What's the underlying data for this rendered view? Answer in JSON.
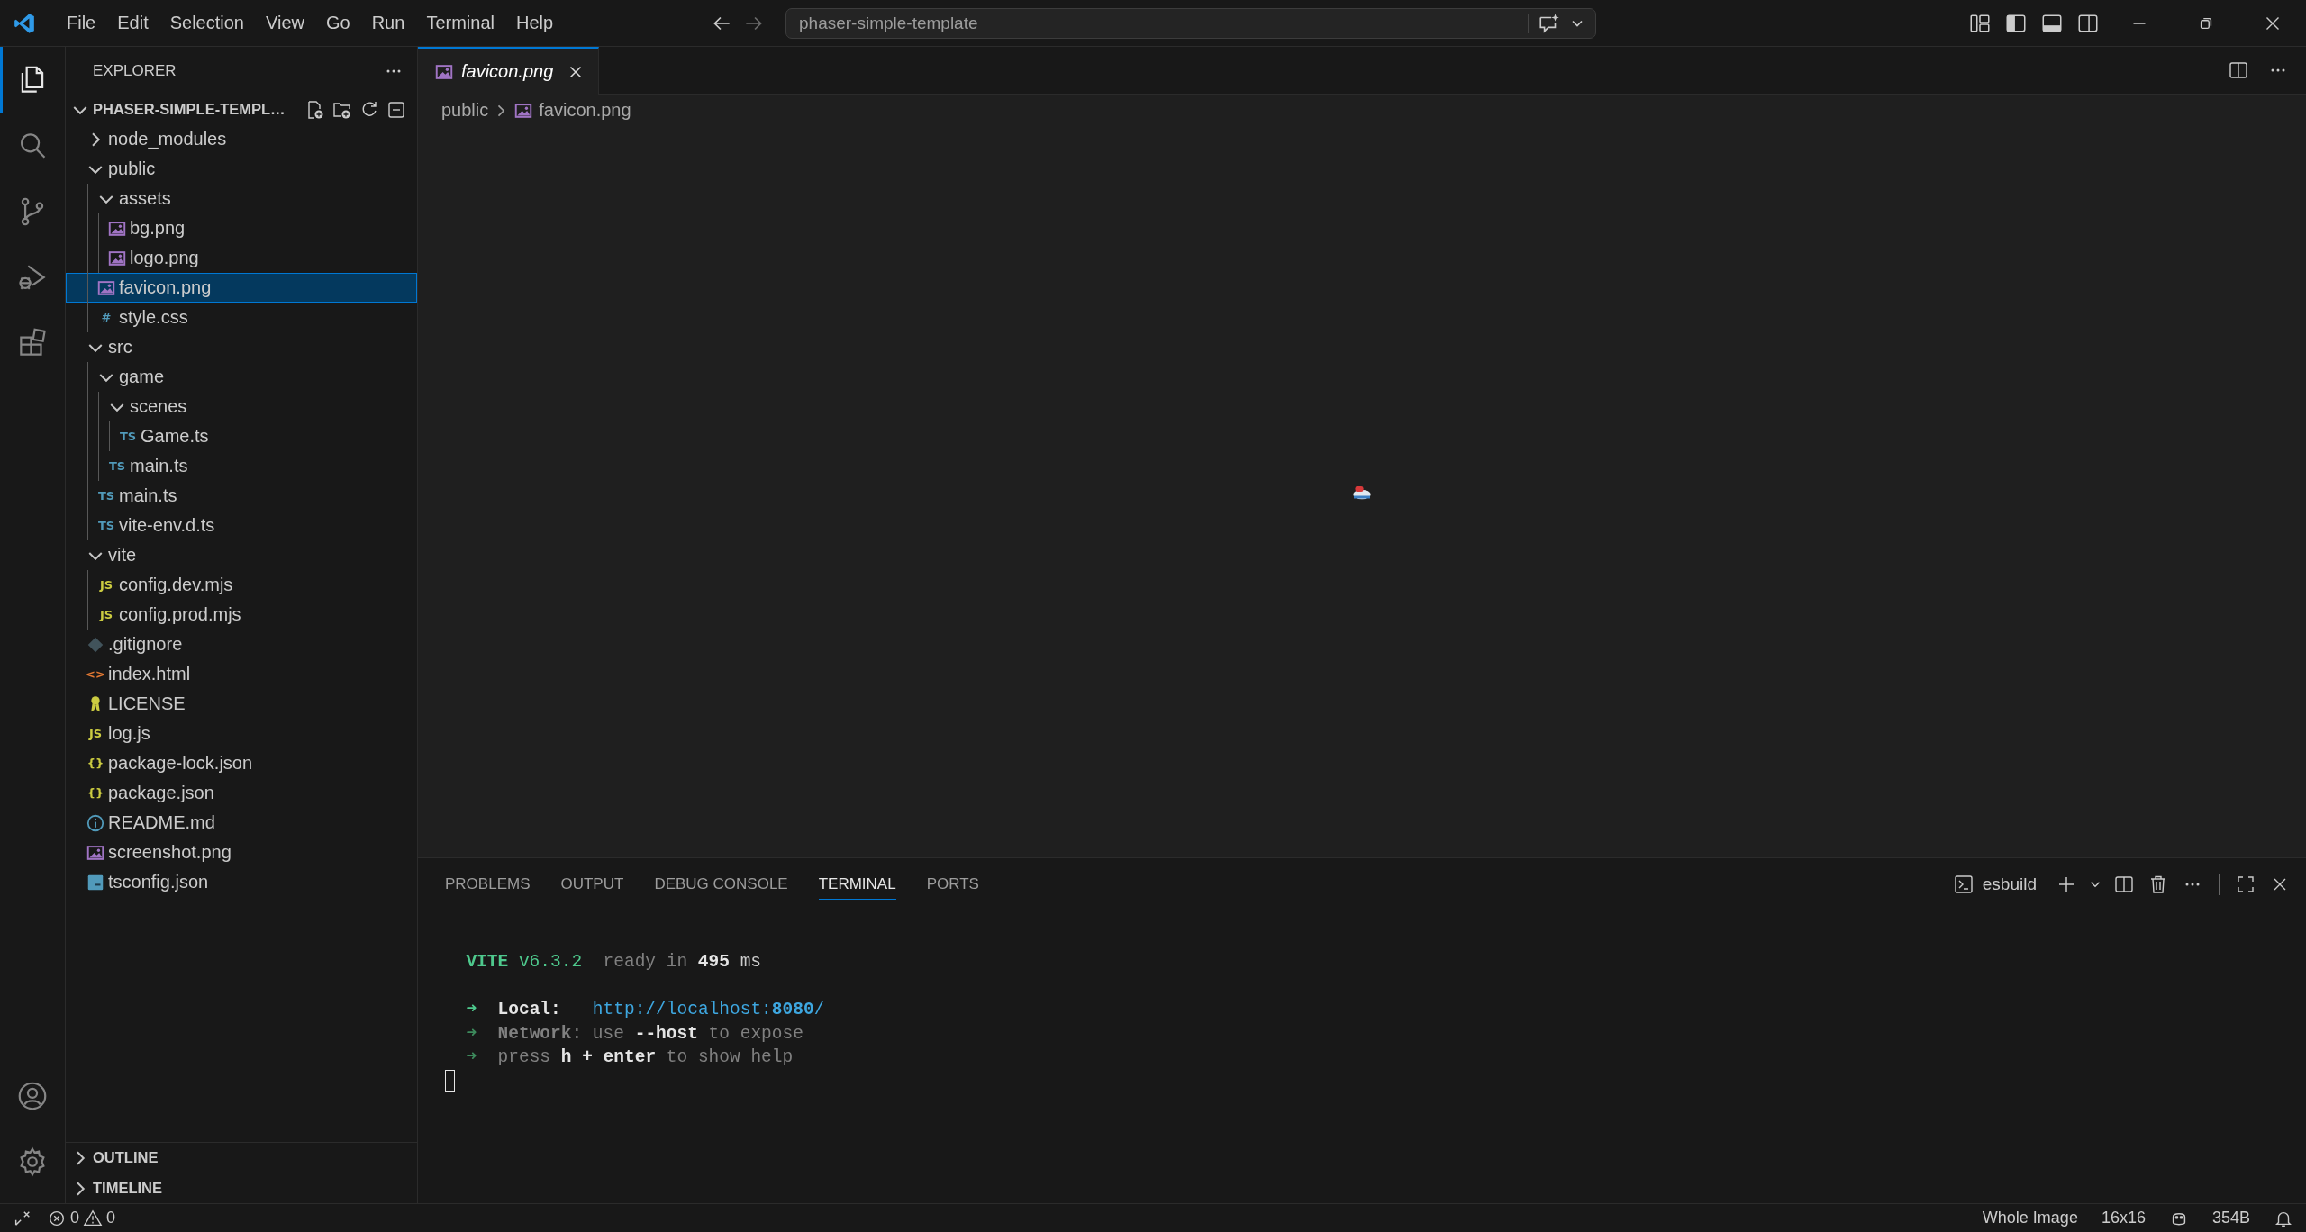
{
  "title_bar": {
    "menu": [
      "File",
      "Edit",
      "Selection",
      "View",
      "Go",
      "Run",
      "Terminal",
      "Help"
    ],
    "command_center": {
      "label": "phaser-simple-template"
    }
  },
  "activity_bar": {
    "items": [
      {
        "kind": "explorer",
        "selected": true
      },
      {
        "kind": "search",
        "selected": false
      },
      {
        "kind": "source-control",
        "selected": false
      },
      {
        "kind": "run-debug",
        "selected": false
      },
      {
        "kind": "extensions",
        "selected": false
      }
    ],
    "bottom": [
      {
        "kind": "account"
      },
      {
        "kind": "settings"
      }
    ]
  },
  "sidebar": {
    "title": "EXPLORER",
    "root": {
      "label": "PHASER-SIMPLE-TEMPL…",
      "expanded": true
    },
    "tree": [
      {
        "label": "node_modules",
        "kind": "folder",
        "expanded": false,
        "selected": false
      },
      {
        "label": "public",
        "kind": "folder",
        "expanded": true,
        "selected": false,
        "children": [
          {
            "label": "assets",
            "kind": "folder",
            "expanded": true,
            "selected": false,
            "children": [
              {
                "label": "bg.png",
                "kind": "image",
                "selected": false
              },
              {
                "label": "logo.png",
                "kind": "image",
                "selected": false
              }
            ]
          },
          {
            "label": "favicon.png",
            "kind": "image",
            "selected": true
          },
          {
            "label": "style.css",
            "kind": "glyph",
            "glyph": "#",
            "selected": false
          }
        ]
      },
      {
        "label": "src",
        "kind": "folder",
        "expanded": true,
        "selected": false,
        "children": [
          {
            "label": "game",
            "kind": "folder",
            "expanded": true,
            "selected": false,
            "children": [
              {
                "label": "scenes",
                "kind": "folder",
                "expanded": true,
                "selected": false,
                "children": [
                  {
                    "label": "Game.ts",
                    "kind": "glyph",
                    "glyph": "TS",
                    "selected": false
                  }
                ]
              },
              {
                "label": "main.ts",
                "kind": "glyph",
                "glyph": "TS",
                "selected": false
              }
            ]
          },
          {
            "label": "main.ts",
            "kind": "glyph",
            "glyph": "TS",
            "selected": false
          },
          {
            "label": "vite-env.d.ts",
            "kind": "glyph",
            "glyph": "TS",
            "selected": false
          }
        ]
      },
      {
        "label": "vite",
        "kind": "folder",
        "expanded": true,
        "selected": false,
        "children": [
          {
            "label": "config.dev.mjs",
            "kind": "glyph",
            "glyph": "JS",
            "selected": false
          },
          {
            "label": "config.prod.mjs",
            "kind": "glyph",
            "glyph": "JS",
            "selected": false
          }
        ]
      },
      {
        "label": ".gitignore",
        "kind": "git",
        "selected": false
      },
      {
        "label": "index.html",
        "kind": "glyph",
        "glyph": "<>",
        "selected": false
      },
      {
        "label": "LICENSE",
        "kind": "license",
        "selected": false
      },
      {
        "label": "log.js",
        "kind": "glyph",
        "glyph": "JS",
        "selected": false
      },
      {
        "label": "package-lock.json",
        "kind": "glyph",
        "glyph": "{}",
        "selected": false
      },
      {
        "label": "package.json",
        "kind": "glyph",
        "glyph": "{}",
        "selected": false
      },
      {
        "label": "README.md",
        "kind": "info",
        "selected": false
      },
      {
        "label": "screenshot.png",
        "kind": "image",
        "selected": false
      },
      {
        "label": "tsconfig.json",
        "kind": "tsconfig",
        "selected": false
      }
    ],
    "sections": [
      {
        "label": "OUTLINE",
        "expanded": false
      },
      {
        "label": "TIMELINE",
        "expanded": false
      }
    ]
  },
  "editor": {
    "tabs": [
      {
        "label": "favicon.png",
        "kind": "image",
        "selected": true,
        "preview": true
      }
    ],
    "breadcrumb": [
      {
        "label": "public",
        "kind": "folder"
      },
      {
        "label": "favicon.png",
        "kind": "image"
      }
    ]
  },
  "panel": {
    "tabs": [
      {
        "label": "PROBLEMS",
        "selected": false
      },
      {
        "label": "OUTPUT",
        "selected": false
      },
      {
        "label": "DEBUG CONSOLE",
        "selected": false
      },
      {
        "label": "TERMINAL",
        "selected": true
      },
      {
        "label": "PORTS",
        "selected": false
      }
    ],
    "terminal": {
      "name": "esbuild",
      "lines": [
        {
          "kind": "header",
          "segments": [
            {
              "text": "VITE",
              "kind": "accent-strong"
            },
            {
              "text": " v6.3.2",
              "kind": "accent"
            },
            {
              "text": "  ready in ",
              "kind": "muted"
            },
            {
              "text": "495",
              "kind": "strong"
            },
            {
              "text": " ms",
              "kind": "plain"
            }
          ]
        },
        {
          "kind": "entry",
          "segments": [
            {
              "text": "➜",
              "kind": "accent-strong"
            },
            {
              "text": "  Local:",
              "kind": "strong"
            },
            {
              "text": "   http://localhost:",
              "kind": "link"
            },
            {
              "text": "8080",
              "kind": "link-strong"
            },
            {
              "text": "/",
              "kind": "link"
            }
          ]
        },
        {
          "kind": "entry",
          "segments": [
            {
              "text": "➜",
              "kind": "accent-dim"
            },
            {
              "text": "  Network",
              "kind": "muted-strong"
            },
            {
              "text": ": use ",
              "kind": "muted"
            },
            {
              "text": "--host",
              "kind": "strong"
            },
            {
              "text": " to expose",
              "kind": "muted"
            }
          ]
        },
        {
          "kind": "entry",
          "segments": [
            {
              "text": "➜",
              "kind": "accent-dim"
            },
            {
              "text": "  press ",
              "kind": "muted"
            },
            {
              "text": "h + enter",
              "kind": "strong"
            },
            {
              "text": " to show help",
              "kind": "muted"
            }
          ]
        }
      ]
    }
  },
  "status_bar": {
    "errors": "0",
    "warnings": "0",
    "right": [
      {
        "kind": "text",
        "label": "Whole Image"
      },
      {
        "kind": "text",
        "label": "16x16"
      },
      {
        "kind": "copilot"
      },
      {
        "kind": "text",
        "label": "354B"
      },
      {
        "kind": "bell"
      }
    ]
  }
}
